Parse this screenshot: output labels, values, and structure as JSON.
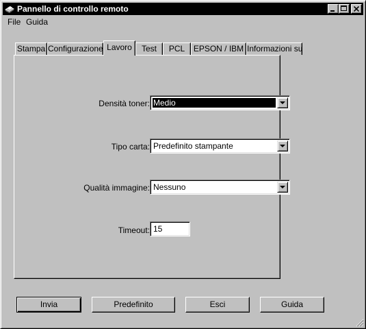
{
  "window": {
    "title": "Pannello di controllo remoto"
  },
  "menu": {
    "file": "File",
    "guida": "Guida"
  },
  "tabs": [
    {
      "label": "Stampa"
    },
    {
      "label": "Configurazione"
    },
    {
      "label": "Lavoro"
    },
    {
      "label": "Test"
    },
    {
      "label": "PCL"
    },
    {
      "label": "EPSON / IBM"
    },
    {
      "label": "Informazioni su"
    }
  ],
  "active_tab": "Lavoro",
  "form": {
    "density": {
      "label": "Densità toner:",
      "value": "Medio"
    },
    "paper": {
      "label": "Tipo carta:",
      "value": "Predefinito stampante"
    },
    "quality": {
      "label": "Qualità immagine:",
      "value": "Nessuno"
    },
    "timeout": {
      "label": "Timeout:",
      "value": "15"
    }
  },
  "buttons": {
    "send": "Invia",
    "default": "Predefinito",
    "exit": "Esci",
    "help": "Guida"
  }
}
